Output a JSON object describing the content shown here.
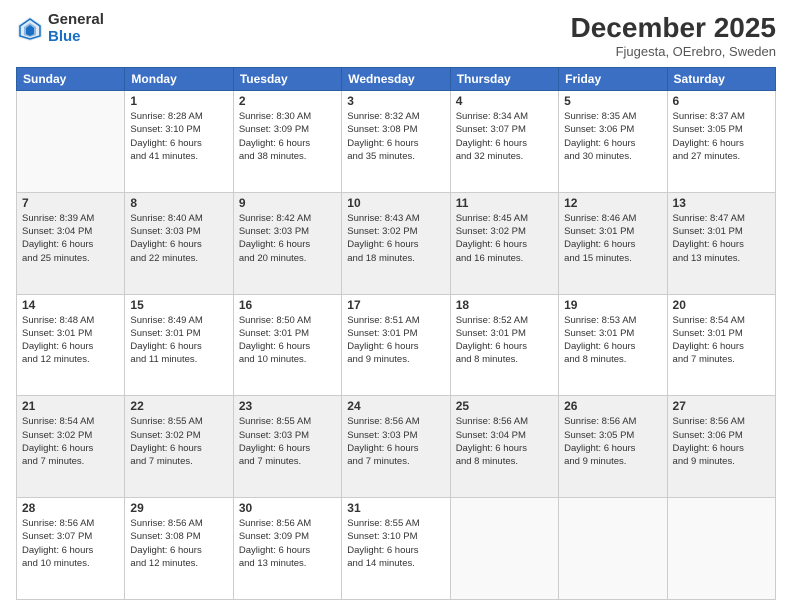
{
  "logo": {
    "general": "General",
    "blue": "Blue"
  },
  "header": {
    "month": "December 2025",
    "location": "Fjugesta, OErebro, Sweden"
  },
  "weekdays": [
    "Sunday",
    "Monday",
    "Tuesday",
    "Wednesday",
    "Thursday",
    "Friday",
    "Saturday"
  ],
  "weeks": [
    [
      {
        "day": "",
        "info": ""
      },
      {
        "day": "1",
        "info": "Sunrise: 8:28 AM\nSunset: 3:10 PM\nDaylight: 6 hours\nand 41 minutes."
      },
      {
        "day": "2",
        "info": "Sunrise: 8:30 AM\nSunset: 3:09 PM\nDaylight: 6 hours\nand 38 minutes."
      },
      {
        "day": "3",
        "info": "Sunrise: 8:32 AM\nSunset: 3:08 PM\nDaylight: 6 hours\nand 35 minutes."
      },
      {
        "day": "4",
        "info": "Sunrise: 8:34 AM\nSunset: 3:07 PM\nDaylight: 6 hours\nand 32 minutes."
      },
      {
        "day": "5",
        "info": "Sunrise: 8:35 AM\nSunset: 3:06 PM\nDaylight: 6 hours\nand 30 minutes."
      },
      {
        "day": "6",
        "info": "Sunrise: 8:37 AM\nSunset: 3:05 PM\nDaylight: 6 hours\nand 27 minutes."
      }
    ],
    [
      {
        "day": "7",
        "info": "Sunrise: 8:39 AM\nSunset: 3:04 PM\nDaylight: 6 hours\nand 25 minutes."
      },
      {
        "day": "8",
        "info": "Sunrise: 8:40 AM\nSunset: 3:03 PM\nDaylight: 6 hours\nand 22 minutes."
      },
      {
        "day": "9",
        "info": "Sunrise: 8:42 AM\nSunset: 3:03 PM\nDaylight: 6 hours\nand 20 minutes."
      },
      {
        "day": "10",
        "info": "Sunrise: 8:43 AM\nSunset: 3:02 PM\nDaylight: 6 hours\nand 18 minutes."
      },
      {
        "day": "11",
        "info": "Sunrise: 8:45 AM\nSunset: 3:02 PM\nDaylight: 6 hours\nand 16 minutes."
      },
      {
        "day": "12",
        "info": "Sunrise: 8:46 AM\nSunset: 3:01 PM\nDaylight: 6 hours\nand 15 minutes."
      },
      {
        "day": "13",
        "info": "Sunrise: 8:47 AM\nSunset: 3:01 PM\nDaylight: 6 hours\nand 13 minutes."
      }
    ],
    [
      {
        "day": "14",
        "info": "Sunrise: 8:48 AM\nSunset: 3:01 PM\nDaylight: 6 hours\nand 12 minutes."
      },
      {
        "day": "15",
        "info": "Sunrise: 8:49 AM\nSunset: 3:01 PM\nDaylight: 6 hours\nand 11 minutes."
      },
      {
        "day": "16",
        "info": "Sunrise: 8:50 AM\nSunset: 3:01 PM\nDaylight: 6 hours\nand 10 minutes."
      },
      {
        "day": "17",
        "info": "Sunrise: 8:51 AM\nSunset: 3:01 PM\nDaylight: 6 hours\nand 9 minutes."
      },
      {
        "day": "18",
        "info": "Sunrise: 8:52 AM\nSunset: 3:01 PM\nDaylight: 6 hours\nand 8 minutes."
      },
      {
        "day": "19",
        "info": "Sunrise: 8:53 AM\nSunset: 3:01 PM\nDaylight: 6 hours\nand 8 minutes."
      },
      {
        "day": "20",
        "info": "Sunrise: 8:54 AM\nSunset: 3:01 PM\nDaylight: 6 hours\nand 7 minutes."
      }
    ],
    [
      {
        "day": "21",
        "info": "Sunrise: 8:54 AM\nSunset: 3:02 PM\nDaylight: 6 hours\nand 7 minutes."
      },
      {
        "day": "22",
        "info": "Sunrise: 8:55 AM\nSunset: 3:02 PM\nDaylight: 6 hours\nand 7 minutes."
      },
      {
        "day": "23",
        "info": "Sunrise: 8:55 AM\nSunset: 3:03 PM\nDaylight: 6 hours\nand 7 minutes."
      },
      {
        "day": "24",
        "info": "Sunrise: 8:56 AM\nSunset: 3:03 PM\nDaylight: 6 hours\nand 7 minutes."
      },
      {
        "day": "25",
        "info": "Sunrise: 8:56 AM\nSunset: 3:04 PM\nDaylight: 6 hours\nand 8 minutes."
      },
      {
        "day": "26",
        "info": "Sunrise: 8:56 AM\nSunset: 3:05 PM\nDaylight: 6 hours\nand 9 minutes."
      },
      {
        "day": "27",
        "info": "Sunrise: 8:56 AM\nSunset: 3:06 PM\nDaylight: 6 hours\nand 9 minutes."
      }
    ],
    [
      {
        "day": "28",
        "info": "Sunrise: 8:56 AM\nSunset: 3:07 PM\nDaylight: 6 hours\nand 10 minutes."
      },
      {
        "day": "29",
        "info": "Sunrise: 8:56 AM\nSunset: 3:08 PM\nDaylight: 6 hours\nand 12 minutes."
      },
      {
        "day": "30",
        "info": "Sunrise: 8:56 AM\nSunset: 3:09 PM\nDaylight: 6 hours\nand 13 minutes."
      },
      {
        "day": "31",
        "info": "Sunrise: 8:55 AM\nSunset: 3:10 PM\nDaylight: 6 hours\nand 14 minutes."
      },
      {
        "day": "",
        "info": ""
      },
      {
        "day": "",
        "info": ""
      },
      {
        "day": "",
        "info": ""
      }
    ]
  ]
}
